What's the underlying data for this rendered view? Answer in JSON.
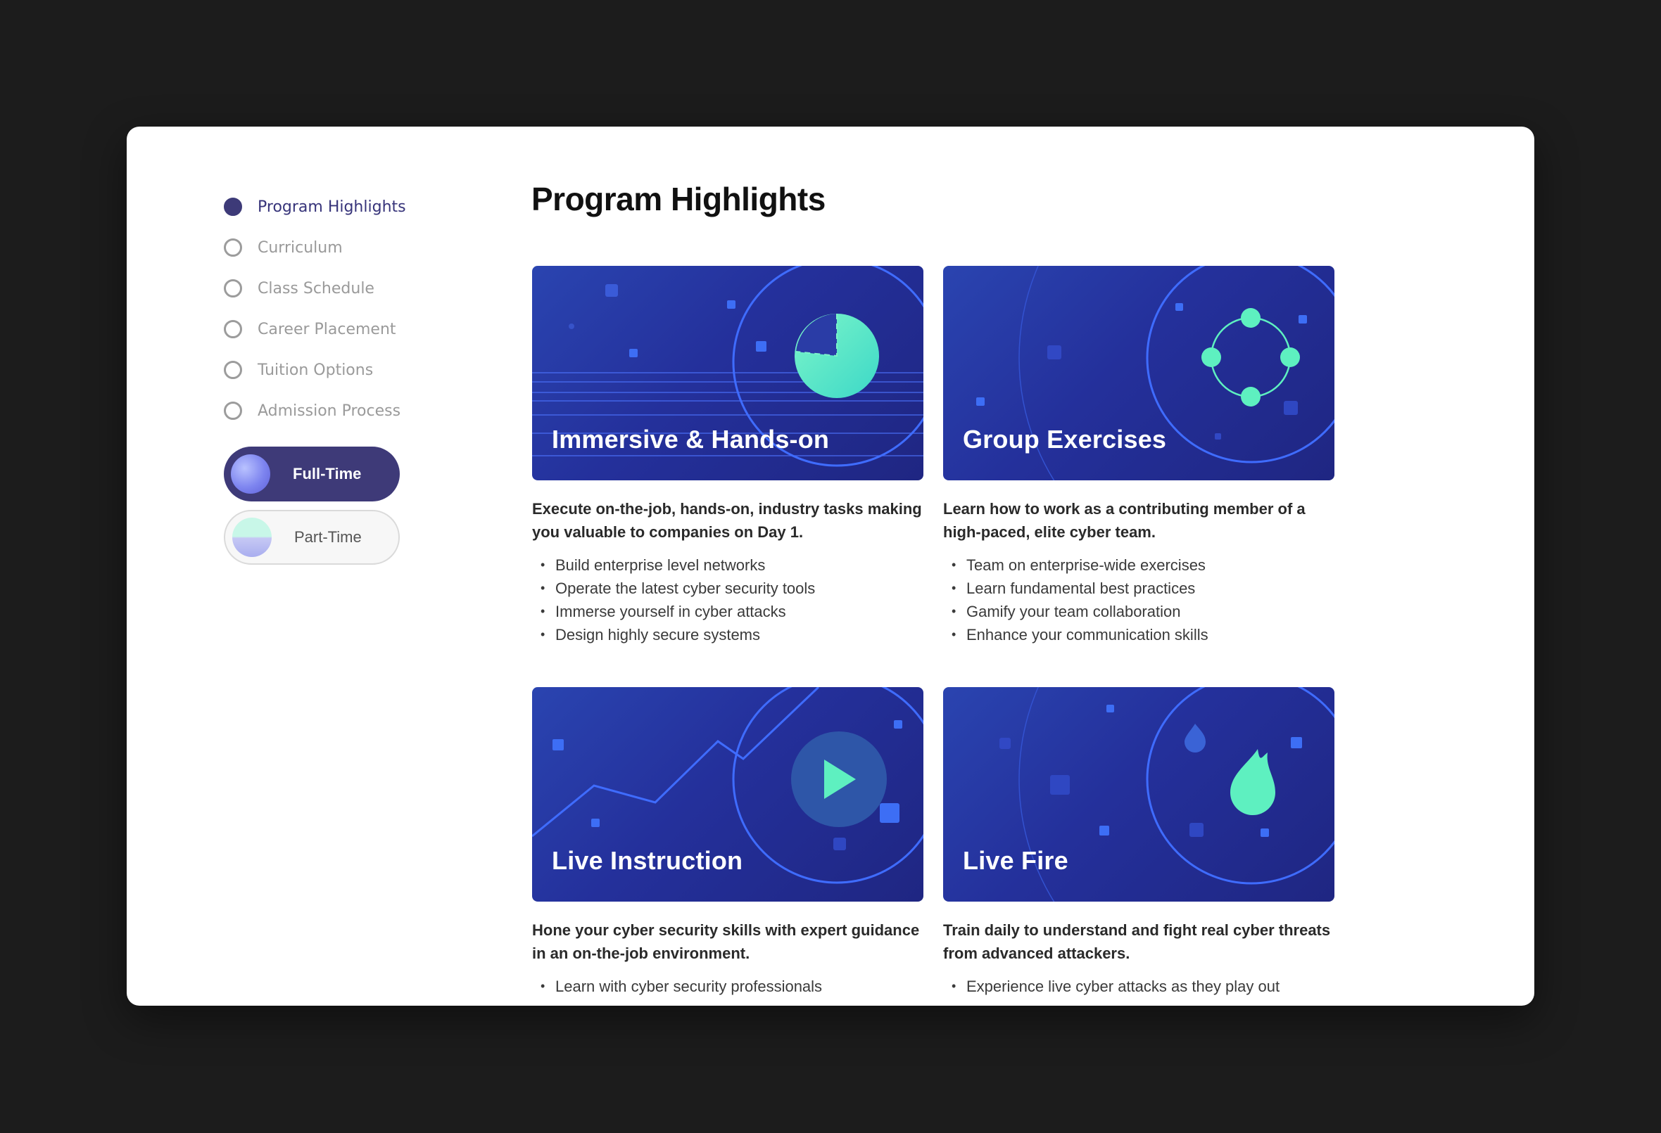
{
  "sidebar": {
    "items": [
      {
        "label": "Program Highlights",
        "active": true
      },
      {
        "label": "Curriculum",
        "active": false
      },
      {
        "label": "Class Schedule",
        "active": false
      },
      {
        "label": "Career Placement",
        "active": false
      },
      {
        "label": "Tuition Options",
        "active": false
      },
      {
        "label": "Admission Process",
        "active": false
      }
    ],
    "toggles": [
      {
        "label": "Full-Time",
        "selected": true
      },
      {
        "label": "Part-Time",
        "selected": false
      }
    ]
  },
  "main": {
    "title": "Program Highlights",
    "cards": [
      {
        "title": "Immersive & Hands-on",
        "icon": "globe-target-icon",
        "description": "Execute on-the-job, hands-on, industry tasks making you valuable to companies on Day 1.",
        "bullets": [
          "Build enterprise level networks",
          "Operate the latest cyber security tools",
          "Immerse yourself in cyber attacks",
          "Design highly secure systems"
        ]
      },
      {
        "title": "Group Exercises",
        "icon": "team-network-icon",
        "description": "Learn how to work as a contributing member of a high-paced, elite cyber team.",
        "bullets": [
          "Team on enterprise-wide exercises",
          "Learn fundamental best practices",
          "Gamify your team collaboration",
          "Enhance your communication skills"
        ]
      },
      {
        "title": "Live Instruction",
        "icon": "play-icon",
        "description": "Hone your cyber security skills with expert guidance in an on-the-job environment.",
        "bullets": [
          "Learn with cyber security professionals"
        ]
      },
      {
        "title": "Live Fire",
        "icon": "flame-icon",
        "description": "Train daily to understand and fight real cyber threats from advanced attackers.",
        "bullets": [
          "Experience live cyber attacks as they play out"
        ]
      }
    ]
  },
  "colors": {
    "accent": "#3e3a78",
    "banner_start": "#2a44b0",
    "banner_end": "#1f2682",
    "mint": "#5ef0c0"
  }
}
